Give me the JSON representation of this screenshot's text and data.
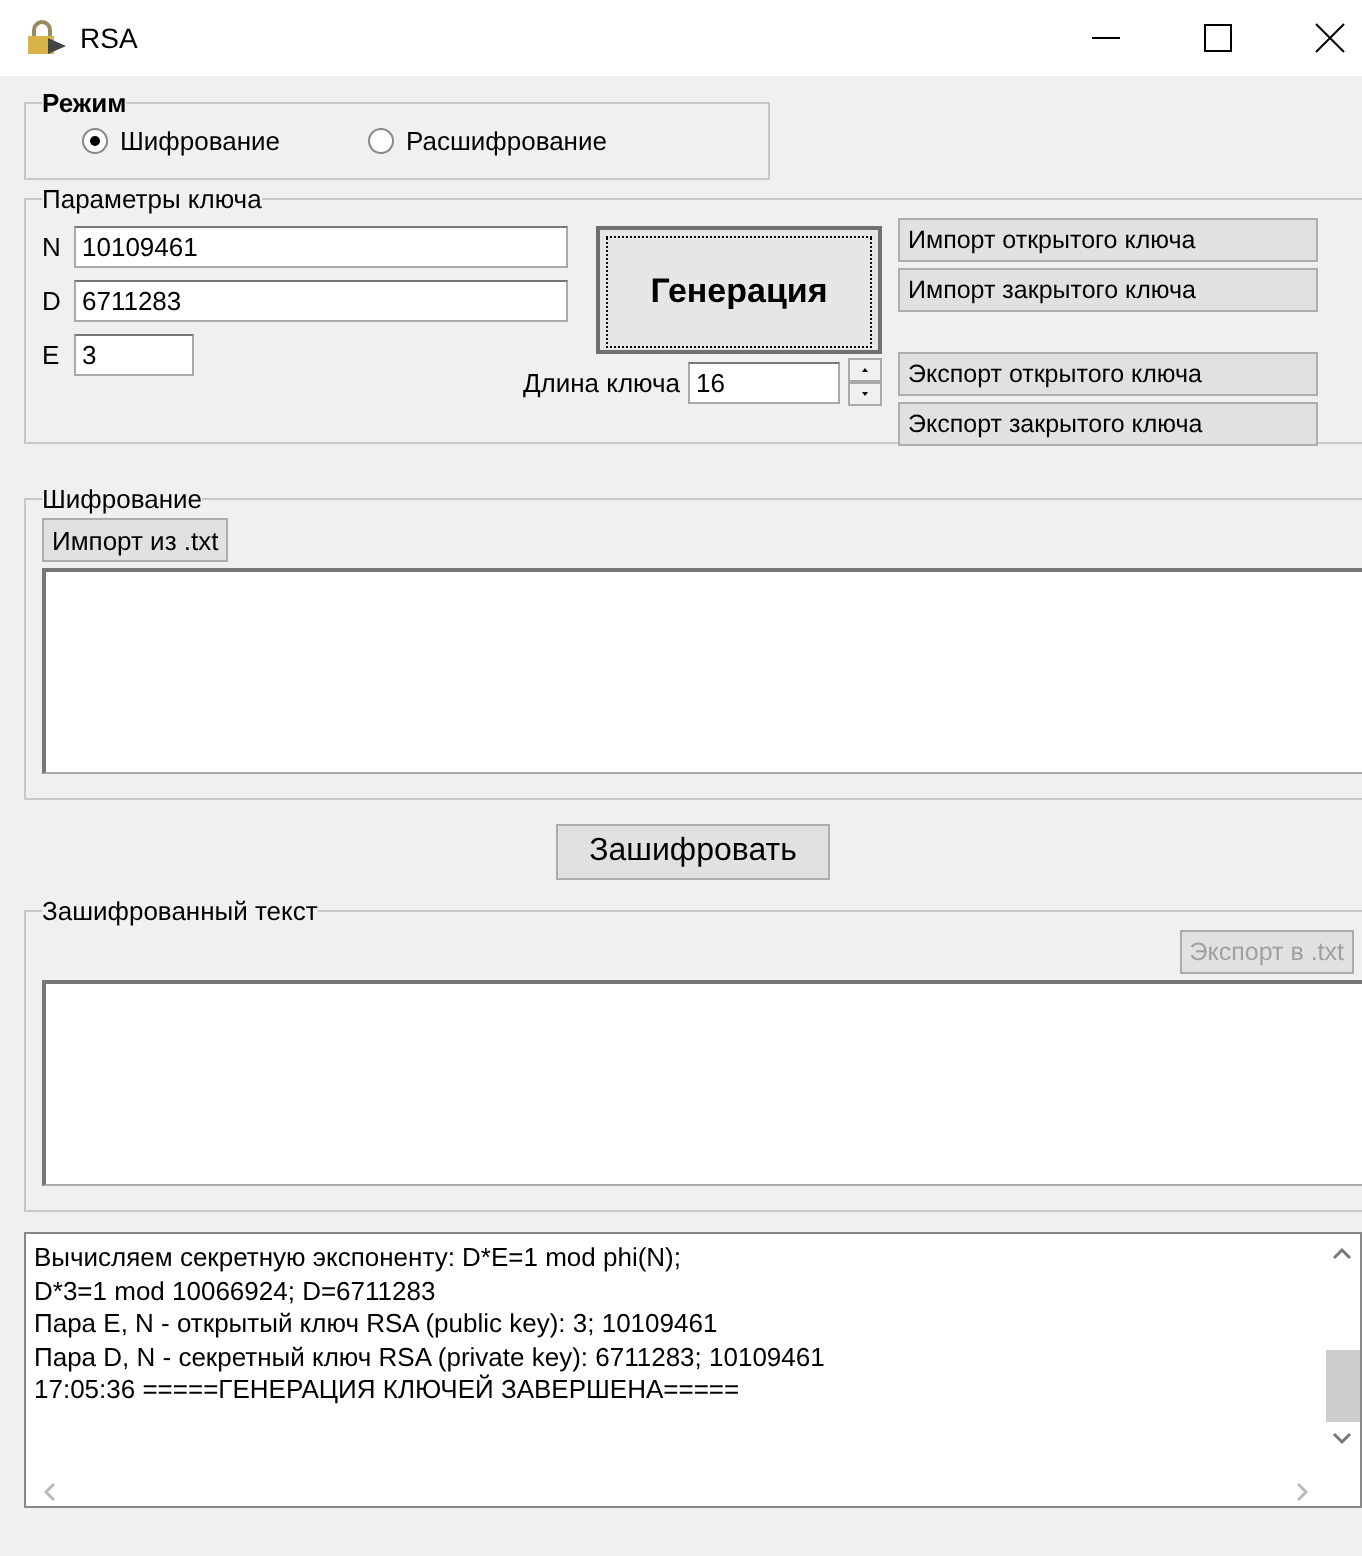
{
  "window": {
    "title": "RSA"
  },
  "mode": {
    "title": "Режим",
    "options": [
      {
        "label": "Шифрование",
        "selected": true
      },
      {
        "label": "Расшифрование",
        "selected": false
      }
    ]
  },
  "key_params": {
    "title": "Параметры ключа",
    "fields": [
      {
        "label": "N",
        "value": "10109461"
      },
      {
        "label": "D",
        "value": "6711283"
      },
      {
        "label": "E",
        "value": "3"
      }
    ],
    "generate_button": "Генерация",
    "key_length": {
      "label": "Длина ключа",
      "value": "16"
    },
    "import_buttons": [
      "Импорт открытого ключа",
      "Импорт закрытого ключа"
    ],
    "export_buttons": [
      "Экспорт открытого ключа",
      "Экспорт закрытого ключа"
    ]
  },
  "encryption": {
    "title": "Шифрование",
    "import_button": "Импорт из .txt"
  },
  "encrypt_button": "Зашифровать",
  "encrypted": {
    "title": "Зашифрованный текст",
    "export_button": {
      "label": "Экспорт в .txt",
      "disabled": true
    }
  },
  "log": [
    "Вычисляем секретную экспоненту: D*E=1 mod phi(N);",
    "D*3=1 mod 10066924; D=6711283",
    "Пара E, N - открытый ключ RSA (public key): 3; 10109461",
    "Пара D, N - секретный ключ RSA (private key): 6711283; 10109461",
    "17:05:36 =====ГЕНЕРАЦИЯ КЛЮЧЕЙ ЗАВЕРШЕНА====="
  ]
}
